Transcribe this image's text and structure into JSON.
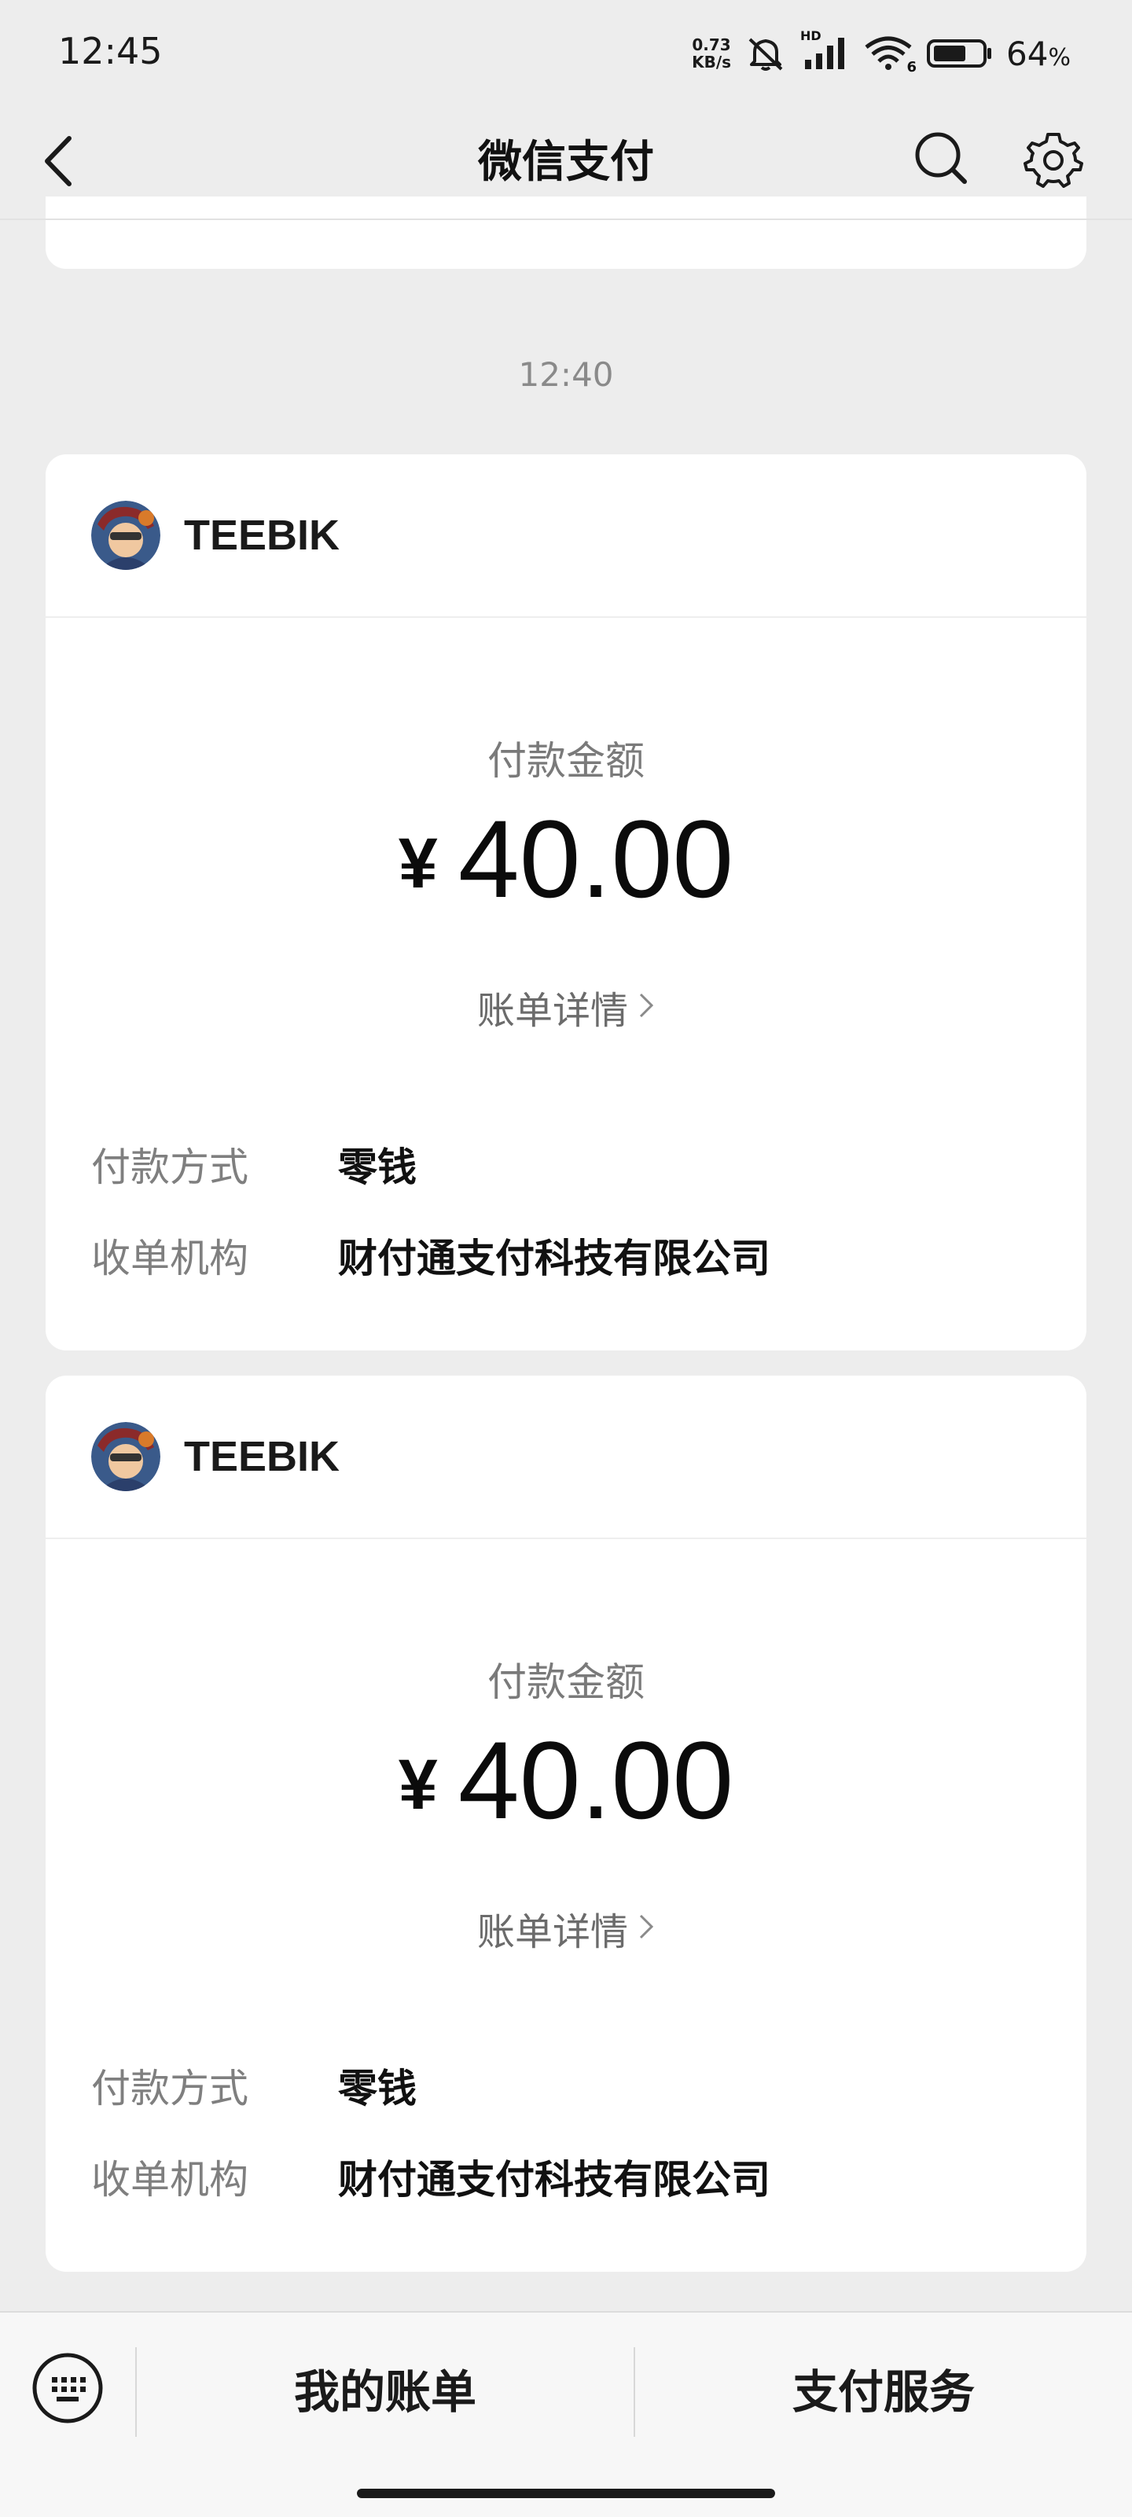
{
  "status_bar": {
    "time": "12:45",
    "net_speed_value": "0.73",
    "net_speed_unit": "KB/s",
    "hd_label": "HD",
    "wifi_label": "6",
    "battery_value": "64",
    "battery_unit": "%",
    "icons": [
      "mute-icon",
      "signal-icon",
      "wifi-icon",
      "battery-icon"
    ]
  },
  "nav": {
    "title": "微信支付",
    "icons": [
      "back-icon",
      "search-icon",
      "gear-icon"
    ]
  },
  "timestamp": "12:40",
  "cards": [
    {
      "merchant": "TEEBIK",
      "amount_label": "付款金额",
      "currency": "¥",
      "amount": "40.00",
      "bill_link": "账单详情",
      "rows": [
        {
          "key": "付款方式",
          "value": "零钱"
        },
        {
          "key": "收单机构",
          "value": "财付通支付科技有限公司"
        }
      ]
    },
    {
      "merchant": "TEEBIK",
      "amount_label": "付款金额",
      "currency": "¥",
      "amount": "40.00",
      "bill_link": "账单详情",
      "rows": [
        {
          "key": "付款方式",
          "value": "零钱"
        },
        {
          "key": "收单机构",
          "value": "财付通支付科技有限公司"
        }
      ]
    }
  ],
  "bottom_bar": {
    "left_button": "我的账单",
    "right_button": "支付服务",
    "icons": [
      "keyboard-icon"
    ]
  },
  "colors": {
    "background": "#ededed",
    "card": "#ffffff",
    "muted_text": "#7f7f7f",
    "primary_text": "#111111"
  }
}
